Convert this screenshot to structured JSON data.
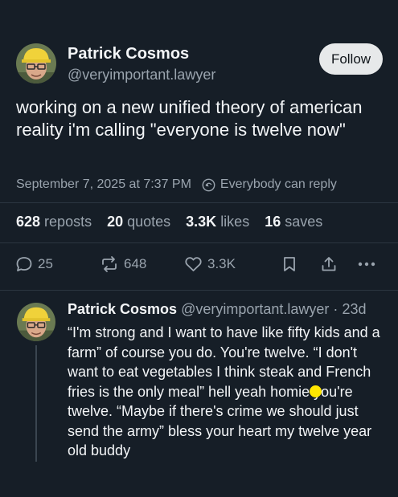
{
  "post": {
    "author_name": "Patrick Cosmos",
    "author_handle": "@veryimportant.lawyer",
    "follow_label": "Follow",
    "text": "working on a new unified theory of american reality i'm calling \"everyone is twelve now\"",
    "timestamp": "September 7, 2025 at 7:37 PM",
    "reply_setting": "Everybody can reply"
  },
  "stats": {
    "reposts_count": "628",
    "reposts_label": "reposts",
    "quotes_count": "20",
    "quotes_label": "quotes",
    "likes_count": "3.3K",
    "likes_label": "likes",
    "saves_count": "16",
    "saves_label": "saves"
  },
  "actions": {
    "reply_count": "25",
    "repost_count": "648",
    "like_count": "3.3K",
    "icons": [
      "reply-icon",
      "repost-icon",
      "heart-icon",
      "bookmark-icon",
      "share-icon",
      "more-icon"
    ]
  },
  "reply": {
    "author_name": "Patrick Cosmos",
    "author_handle": "@veryimportant.lawyer",
    "separator": "·",
    "age": "23d",
    "text": "“I'm strong and I want to have like fifty kids and a farm” of course you do. You're twelve. “I don't want to eat vegetables I think steak and French fries is the only meal” hell yeah homie you're twelve. “Maybe if there's crime we should just send the army” bless your heart my twelve year old buddy"
  },
  "colors": {
    "background": "#161e27",
    "text": "#f3f5f7",
    "muted": "#9aa4ae",
    "follow_bg": "#e7e9ea",
    "highlight_dot": "#ffe600"
  }
}
